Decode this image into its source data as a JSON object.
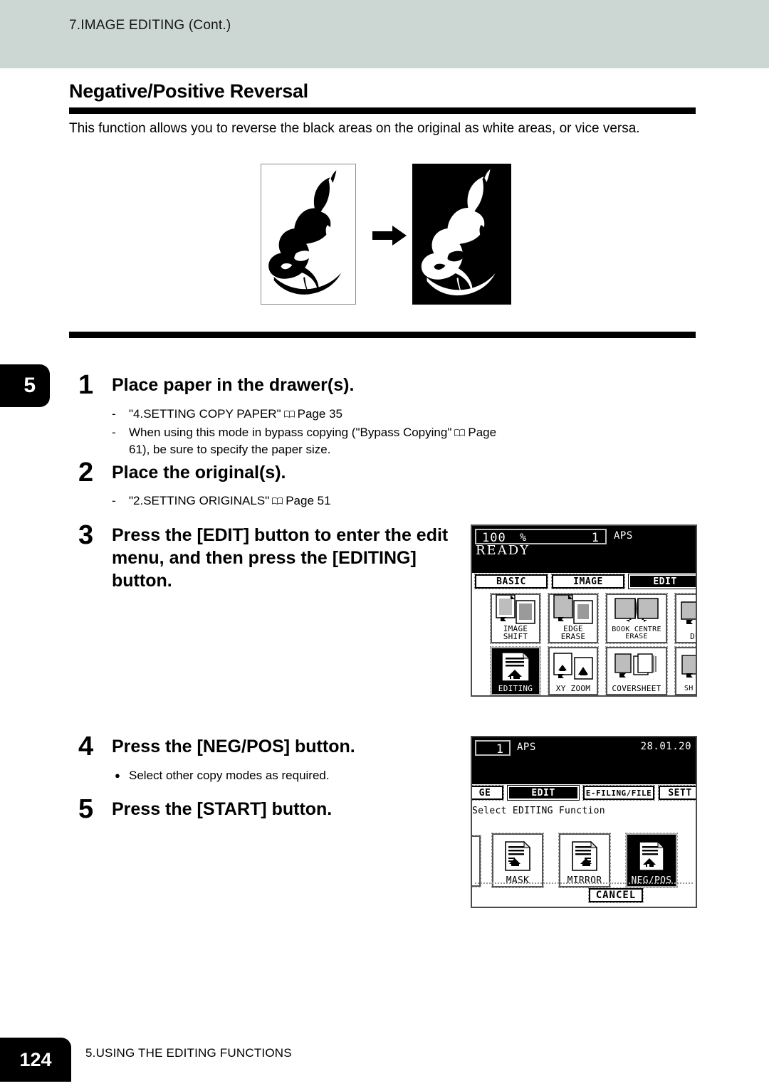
{
  "header": {
    "running_head": "7.IMAGE EDITING (Cont.)"
  },
  "section": {
    "title": "Negative/Positive Reversal",
    "intro": "This function allows you to reverse the black areas on the original as white areas, or vice versa."
  },
  "chapter_tab": {
    "number": "5"
  },
  "illustration": {
    "original_label": "original-whale-positive",
    "arrow_label": "right-arrow",
    "result_label": "result-whale-negative"
  },
  "steps": [
    {
      "number": "1",
      "heading": "Place paper in the drawer(s).",
      "notes": [
        {
          "marker": "-",
          "pre": "\"4.SETTING COPY PAPER\"",
          "icon": "book-icon",
          "post": "Page 35"
        },
        {
          "marker": "-",
          "pre": "When using this mode in bypass copying (\"Bypass Copying\"",
          "icon": "book-icon",
          "post": "Page 61), be sure to specify the paper size."
        }
      ]
    },
    {
      "number": "2",
      "heading": "Place the original(s).",
      "notes": [
        {
          "marker": "-",
          "pre": "\"2.SETTING ORIGINALS\"",
          "icon": "book-icon",
          "post": "Page 51"
        }
      ]
    },
    {
      "number": "3",
      "heading": "Press the [EDIT] button to enter the edit menu, and then press the [EDITING] button.",
      "notes": []
    },
    {
      "number": "4",
      "heading": "Press the [NEG/POS] button.",
      "notes": [
        {
          "marker": "●",
          "pre": "Select other copy modes as required.",
          "icon": "",
          "post": ""
        }
      ]
    },
    {
      "number": "5",
      "heading": "Press the [START] button.",
      "notes": []
    }
  ],
  "lcd_edit_menu": {
    "zoom": "100",
    "percent": "%",
    "copies": "1",
    "paper_mode": "APS",
    "status": "READY",
    "tabs": [
      {
        "label": "BASIC",
        "selected": false
      },
      {
        "label": "IMAGE",
        "selected": false
      },
      {
        "label": "EDIT",
        "selected": true
      }
    ],
    "functions_row1": [
      {
        "label": "IMAGE SHIFT",
        "selected": false,
        "icon": "image-shift-icon"
      },
      {
        "label": "EDGE ERASE",
        "selected": false,
        "icon": "edge-erase-icon"
      },
      {
        "label": "BOOK CENTRE ERASE",
        "selected": false,
        "icon": "book-centre-erase-icon"
      },
      {
        "label": "DUAL",
        "selected": false,
        "icon": "dual-page-icon"
      }
    ],
    "functions_row2": [
      {
        "label": "EDITING",
        "selected": true,
        "icon": "editing-icon"
      },
      {
        "label": "XY ZOOM",
        "selected": false,
        "icon": "xy-zoom-icon"
      },
      {
        "label": "COVERSHEET",
        "selected": false,
        "icon": "coversheet-icon"
      },
      {
        "label": "SH INSE",
        "selected": false,
        "icon": "sheet-insertion-icon"
      }
    ]
  },
  "lcd_editing_function": {
    "copies": "1",
    "paper_mode": "APS",
    "date": "28.01.20",
    "tabs": [
      {
        "label": "GE",
        "selected": false
      },
      {
        "label": "EDIT",
        "selected": true
      },
      {
        "label": "E-FILING/FILE",
        "selected": false
      },
      {
        "label": "SETT",
        "selected": false
      }
    ],
    "prompt": "Select EDITING Function",
    "functions": [
      {
        "label": "MASK",
        "selected": false,
        "icon": "mask-icon"
      },
      {
        "label": "MIRROR",
        "selected": false,
        "icon": "mirror-icon"
      },
      {
        "label": "NEG/POS",
        "selected": true,
        "icon": "neg-pos-icon"
      }
    ],
    "cancel_label": "CANCEL"
  },
  "footer": {
    "page_number": "124",
    "chapter_title": "5.USING THE EDITING FUNCTIONS"
  },
  "colors": {
    "header_band": "#ccd6d3",
    "rule": "#000000",
    "lcd_bezel": "#4a4a4a"
  }
}
